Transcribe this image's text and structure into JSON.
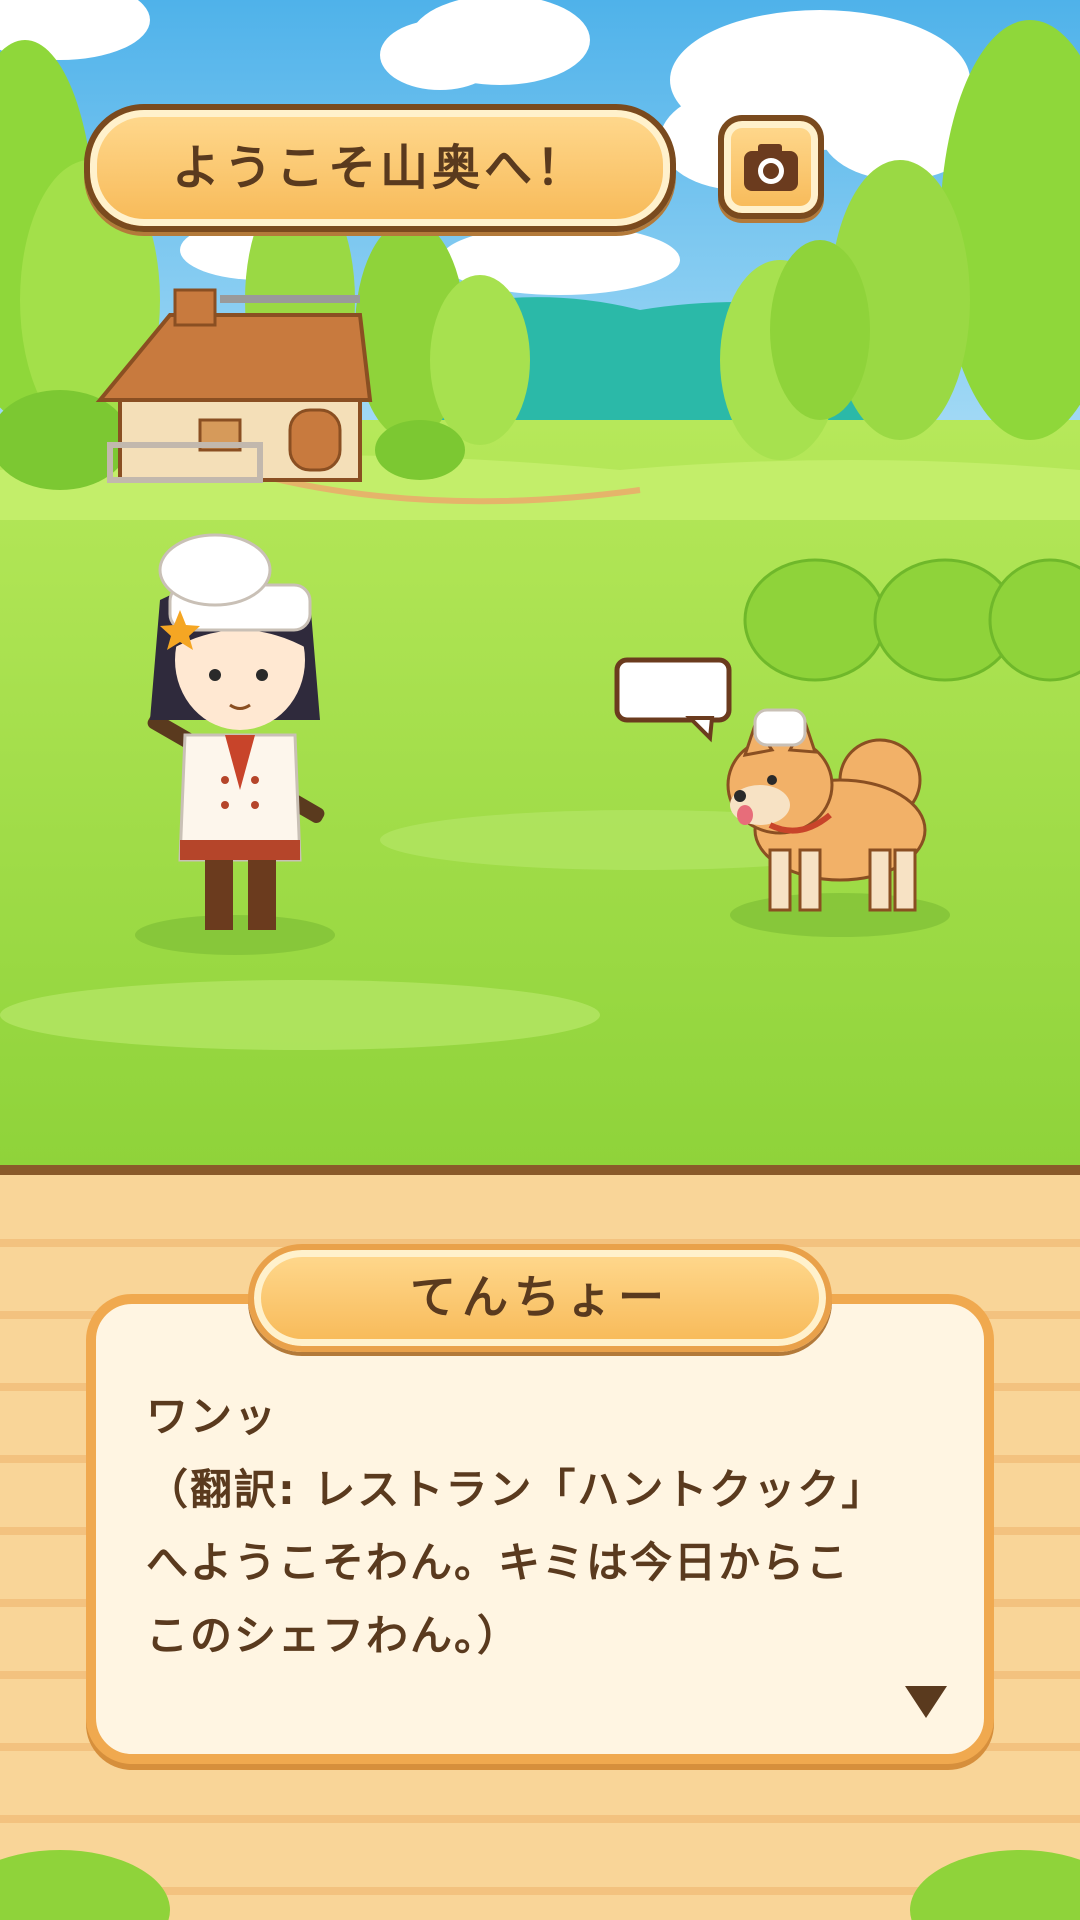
{
  "header": {
    "title": "ようこそ山奥へ！",
    "camera_icon": "camera-icon"
  },
  "scene": {
    "chef_speech_bubble_text": ""
  },
  "dialog": {
    "speaker": "てんちょー",
    "lines": [
      "ワンッ",
      "（翻訳: レストラン「ハントクック」",
      "へようこそわん。キミは今日からこ",
      "このシェフわん。）"
    ],
    "advance_icon": "triangle-down-icon"
  },
  "colors": {
    "banner_fill": "#f7b957",
    "banner_border": "#7a4a1e",
    "dialog_border": "#f0a94f",
    "text": "#5a3a1e",
    "grass": "#9ede3f"
  }
}
